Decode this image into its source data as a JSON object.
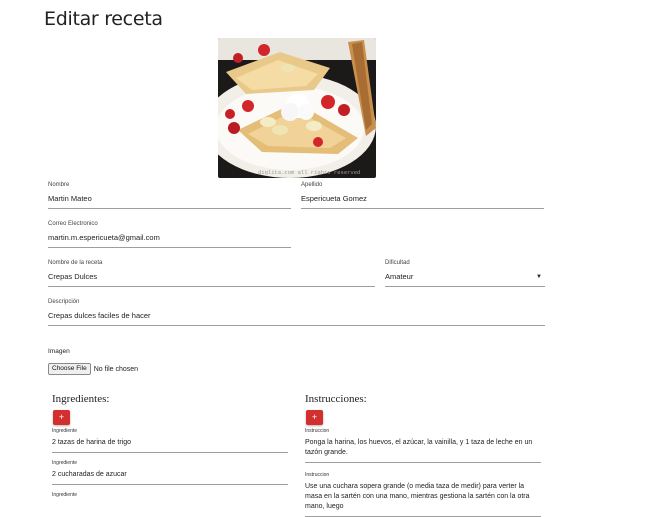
{
  "page": {
    "title": "Editar receta"
  },
  "photo": {
    "watermark": "diqlita.com all rights reserved"
  },
  "form": {
    "nombre": {
      "label": "Nombre",
      "value": "Martin Mateo"
    },
    "apellido": {
      "label": "Apellido",
      "value": "Espericueta Gomez"
    },
    "correo": {
      "label": "Correo Electronico",
      "value": "martin.m.espericueta@gmail.com"
    },
    "receta": {
      "label": "Nombre de la receta",
      "value": "Crepas Dulces"
    },
    "dificultad": {
      "label": "Dificultad",
      "value": "Amateur"
    },
    "descripcion": {
      "label": "Descripción",
      "value": "Crepas dulces faciles de hacer"
    },
    "imagen": {
      "label": "Imagen",
      "button": "Choose File",
      "status": "No file chosen"
    }
  },
  "ingredientes": {
    "title": "Ingredientes:",
    "add_icon": "+",
    "items": [
      {
        "label": "Ingrediente",
        "value": "2 tazas de harina de trigo"
      },
      {
        "label": "Ingrediente",
        "value": "2 cucharadas de azucar"
      },
      {
        "label": "Ingrediente",
        "value": ""
      }
    ]
  },
  "instrucciones": {
    "title": "Instrucciones:",
    "add_icon": "+",
    "items": [
      {
        "label": "Instruccion",
        "value": "Ponga la harina, los huevos, el azúcar, la vainilla, y 1 taza de leche en un tazón grande."
      },
      {
        "label": "Instruccion",
        "value": "Use una cuchara sopera grande (o media taza de medir) para verter la masa en la sartén con una mano, mientras gestiona la sartén con la otra mano, luego"
      }
    ]
  },
  "colors": {
    "accent": "#d32f2f",
    "underline": "#9e9e9e"
  },
  "icons": {
    "select_caret": "caret-down-icon",
    "add": "plus-icon"
  }
}
